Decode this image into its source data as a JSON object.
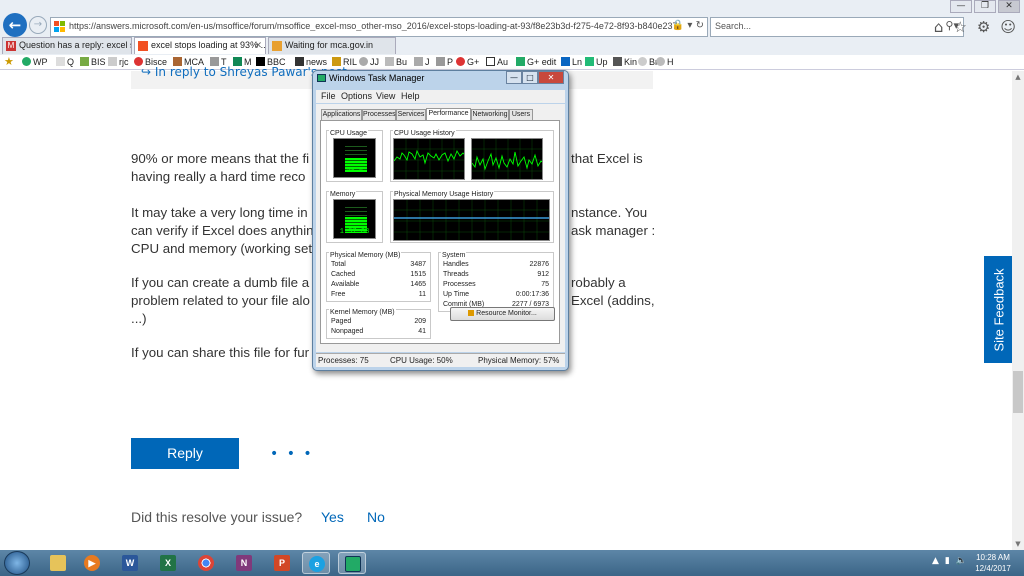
{
  "browser": {
    "url": "https://answers.microsoft.com/en-us/msoffice/forum/msoffice_excel-mso_other-mso_2016/excel-stops-loading-at-93/f8e23b3d-f275-4e72-8f93-b840e2376397",
    "search_placeholder": "Search...",
    "tabs": [
      {
        "label": "Question has a reply: excel sto..."
      },
      {
        "label": "excel stops loading at 93% ..."
      },
      {
        "label": "Waiting for mca.gov.in"
      }
    ],
    "favorites": [
      "WP",
      "Q",
      "BIS",
      "rjc",
      "Bisce",
      "MCA",
      "T",
      "M",
      "BBC",
      "news",
      "RIL",
      "JJ",
      "Bu",
      "J",
      "P",
      "G+",
      "Au",
      "G+ edit",
      "Ln",
      "Up",
      "Kin",
      "Br",
      "H"
    ]
  },
  "page": {
    "quote_link": "↪ In reply to Shreyas Pawar's post",
    "paragraphs": [
      {
        "line1": "90% or more means that the fi",
        "line1b": "that Excel is",
        "line2": "having really a hard time reco"
      },
      {
        "line1": "It may take a very long time in",
        "line1b": "nstance. You",
        "line2": "can verify if Excel does anythin",
        "line2b": "ask manager :",
        "line3": "CPU and memory (working set"
      },
      {
        "line1": "If you can create a dumb file a",
        "line1b": "robably a",
        "line2": "problem related to your file alo",
        "line2b": "Excel (addins,",
        "line3": "...)"
      },
      {
        "line1": "If you can share this file for fur"
      }
    ],
    "reply_label": "Reply",
    "more_label": "• • •",
    "resolve_question": "Did this resolve your issue?",
    "yes_label": "Yes",
    "no_label": "No",
    "feedback_label": "Site Feedback"
  },
  "task_manager": {
    "title": "Windows Task Manager",
    "menu": [
      "File",
      "Options",
      "View",
      "Help"
    ],
    "tabs": [
      "Applications",
      "Processes",
      "Services",
      "Performance",
      "Networking",
      "Users"
    ],
    "active_tab": "Performance",
    "cpu_usage_label": "CPU Usage",
    "cpu_usage_value": "50 %",
    "cpu_usage_fraction": 0.5,
    "cpu_history_label": "CPU Usage History",
    "memory_label": "Memory",
    "memory_value": "1.97 GB",
    "memory_fraction": 0.57,
    "mem_history_label": "Physical Memory Usage History",
    "physical_memory": {
      "title": "Physical Memory (MB)",
      "rows": [
        {
          "k": "Total",
          "v": "3487"
        },
        {
          "k": "Cached",
          "v": "1515"
        },
        {
          "k": "Available",
          "v": "1465"
        },
        {
          "k": "Free",
          "v": "11"
        }
      ]
    },
    "kernel_memory": {
      "title": "Kernel Memory (MB)",
      "rows": [
        {
          "k": "Paged",
          "v": "209"
        },
        {
          "k": "Nonpaged",
          "v": "41"
        }
      ]
    },
    "system": {
      "title": "System",
      "rows": [
        {
          "k": "Handles",
          "v": "22876"
        },
        {
          "k": "Threads",
          "v": "912"
        },
        {
          "k": "Processes",
          "v": "75"
        },
        {
          "k": "Up Time",
          "v": "0:00:17:36"
        },
        {
          "k": "Commit (MB)",
          "v": "2277 / 6973"
        }
      ]
    },
    "resource_monitor_label": "Resource Monitor...",
    "status": {
      "processes": "Processes: 75",
      "cpu": "CPU Usage: 50%",
      "memory": "Physical Memory: 57%"
    }
  },
  "taskbar": {
    "clock_time": "10:28 AM",
    "clock_date": "12/4/2017"
  },
  "colors": {
    "accent": "#0067b8",
    "graph_green": "#00ff00"
  }
}
